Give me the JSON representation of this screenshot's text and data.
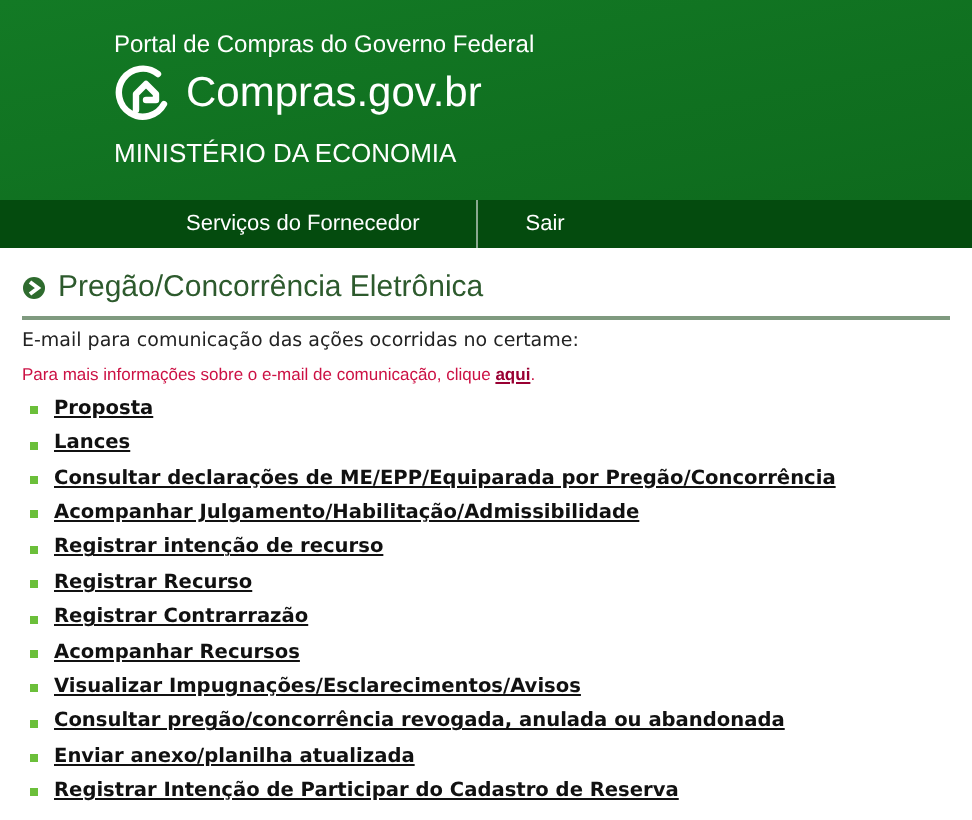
{
  "header": {
    "portal": "Portal de Compras do Governo Federal",
    "logo_text": "Compras.gov.br",
    "ministry": "MINISTÉRIO DA ECONOMIA"
  },
  "nav": [
    "Serviços do Fornecedor",
    "Sair"
  ],
  "page_title": "Pregão/Concorrência Eletrônica",
  "email_label": "E-mail para comunicação das ações ocorridas no certame:",
  "info": {
    "text": "Para mais informações sobre o e-mail de comunicação, clique ",
    "link": "aqui",
    "end": "."
  },
  "links": [
    "Proposta",
    "Lances",
    "Consultar declarações de ME/EPP/Equiparada por Pregão/Concorrência",
    "Acompanhar Julgamento/Habilitação/Admissibilidade",
    "Registrar intenção de recurso",
    "Registrar Recurso",
    "Registrar Contrarrazão",
    "Acompanhar Recursos",
    "Visualizar Impugnações/Esclarecimentos/Avisos",
    "Consultar pregão/concorrência revogada, anulada ou abandonada",
    "Enviar anexo/planilha atualizada",
    "Registrar Intenção de Participar do Cadastro de Reserva"
  ]
}
